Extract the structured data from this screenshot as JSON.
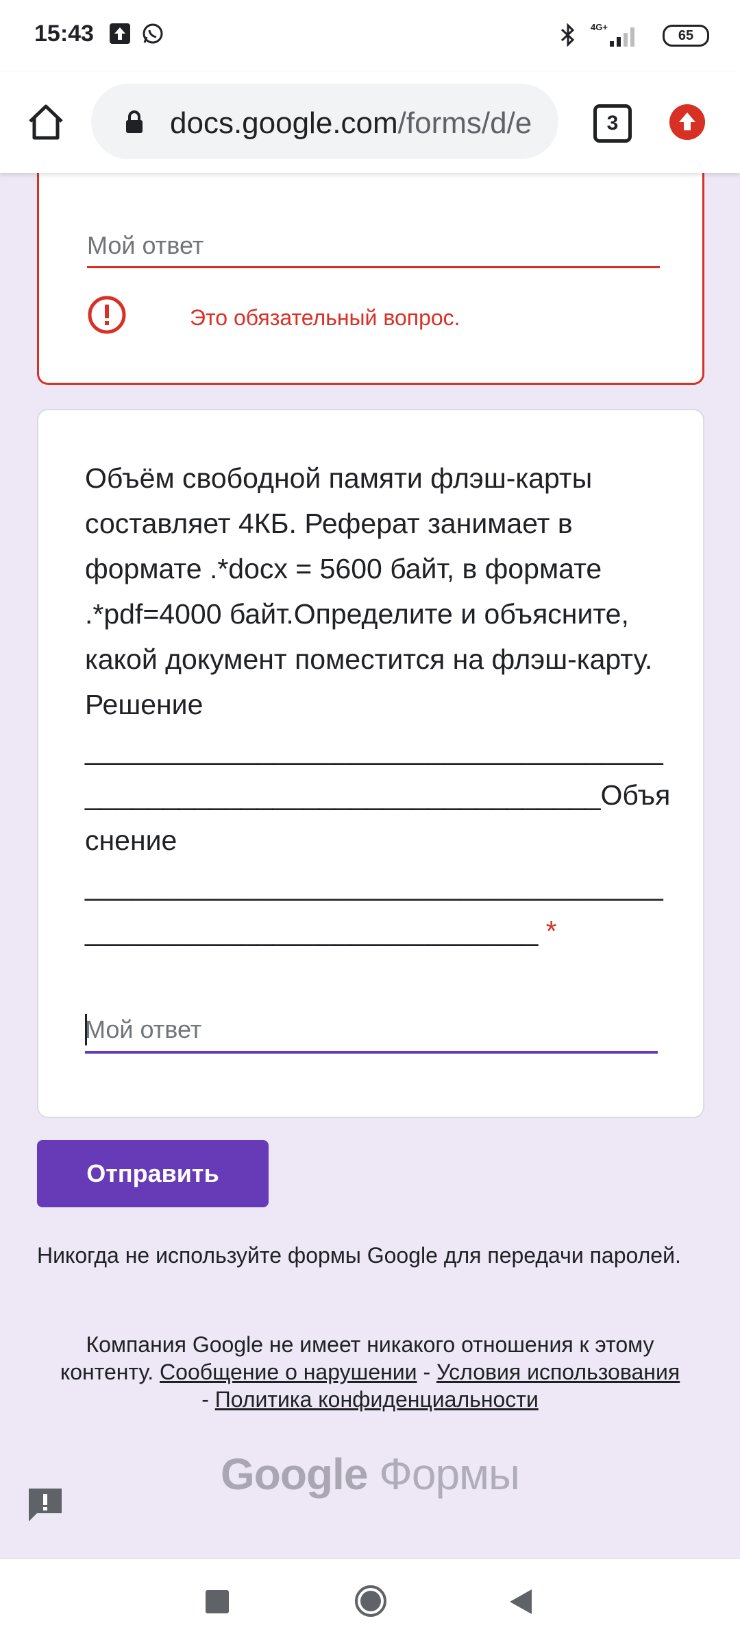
{
  "status_bar": {
    "time": "15:43",
    "network": "4G+",
    "battery": "65",
    "icons": [
      "upload-icon",
      "whatsapp-icon",
      "bluetooth-icon",
      "signal-icon",
      "battery-icon"
    ]
  },
  "browser": {
    "url_domain": "docs.google.com",
    "url_path": "/forms/d/e",
    "tab_count": "3",
    "icons": [
      "home-icon",
      "lock-icon",
      "tabs-icon",
      "update-icon"
    ]
  },
  "form": {
    "card1": {
      "placeholder": "Мой ответ",
      "error_text": "Это обязательный вопрос."
    },
    "card2": {
      "question": "Объём свободной памяти флэш-карты составляет 4КБ. Реферат занимает в формате .*docx = 5600 байт, в формате .*pdf=4000 байт.Определите и объясните, какой документ поместится на флэш-карту. Решение ______________________________________________________________________Объяснение __________________________________________________________________",
      "required_mark": "*",
      "placeholder": "Мой ответ"
    },
    "submit_label": "Отправить",
    "password_warning": "Никогда не используйте формы Google для передачи паролей.",
    "legal": {
      "prefix": "Компания Google не имеет никакого отношения к этому контенту.",
      "report_link": "Сообщение о нарушении",
      "sep1": "-",
      "terms_link": "Условия использования",
      "sep2": "-",
      "privacy_link": "Политика конфиденциальности"
    },
    "logo_google": "Google",
    "logo_forms": "Формы"
  },
  "colors": {
    "accent": "#673ab7",
    "error": "#d93025",
    "background": "#ede7f6"
  }
}
